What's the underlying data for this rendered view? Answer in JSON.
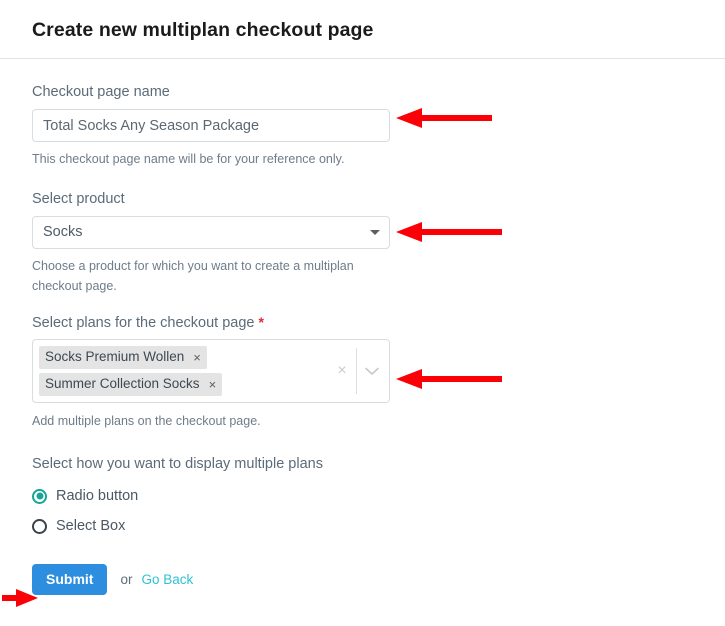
{
  "header": {
    "title": "Create new multiplan checkout page"
  },
  "form": {
    "name_field": {
      "label": "Checkout page name",
      "value": "Total Socks Any Season Package",
      "placeholder": "Total Socks Any Season Package",
      "help": "This checkout page name will be for your reference only."
    },
    "product_field": {
      "label": "Select product",
      "selected": "Socks",
      "caret_icon": "chevron-down-icon",
      "help": "Choose a product for which you want to create a multiplan checkout page."
    },
    "plans_field": {
      "label": "Select plans for the checkout page",
      "required_marker": "*",
      "chips": [
        {
          "label": "Socks Premium Wollen",
          "remove_icon": "×"
        },
        {
          "label": "Summer Collection Socks",
          "remove_icon": "×"
        }
      ],
      "clear_icon": "×",
      "chevron_icon": "chevron-down-icon",
      "help": "Add multiple plans on the checkout page."
    },
    "display_field": {
      "label": "Select how you want to display multiple plans",
      "options": [
        {
          "label": "Radio button",
          "selected": true
        },
        {
          "label": "Select Box",
          "selected": false
        }
      ]
    }
  },
  "footer": {
    "submit_label": "Submit",
    "or_label": "or",
    "go_back_label": "Go Back"
  },
  "colors": {
    "accent_blue": "#2d8ee0",
    "link_teal": "#2ec2d6",
    "radio_teal": "#16a596",
    "required_red": "#e02b32",
    "annotation_red": "#fb0007",
    "label_slate": "#5b6b79",
    "chip_bg": "#e4e4e4",
    "border_gray": "#d8dde2"
  },
  "annotations": [
    {
      "name": "arrow-to-name-input",
      "direction": "left"
    },
    {
      "name": "arrow-to-product-select",
      "direction": "left"
    },
    {
      "name": "arrow-to-plans-multiselect",
      "direction": "left"
    },
    {
      "name": "arrow-to-submit-button",
      "direction": "right"
    }
  ]
}
